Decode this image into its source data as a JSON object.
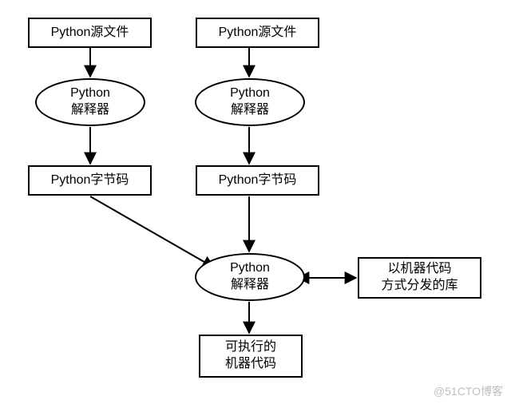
{
  "nodes": {
    "source_left": "Python源文件",
    "source_right": "Python源文件",
    "interp_left": "Python\n解释器",
    "interp_right": "Python\n解释器",
    "bytecode_left": "Python字节码",
    "bytecode_right": "Python字节码",
    "interp_center": "Python\n解释器",
    "library": "以机器代码\n方式分发的库",
    "executable": "可执行的\n机器代码"
  },
  "watermark": "@51CTO博客"
}
